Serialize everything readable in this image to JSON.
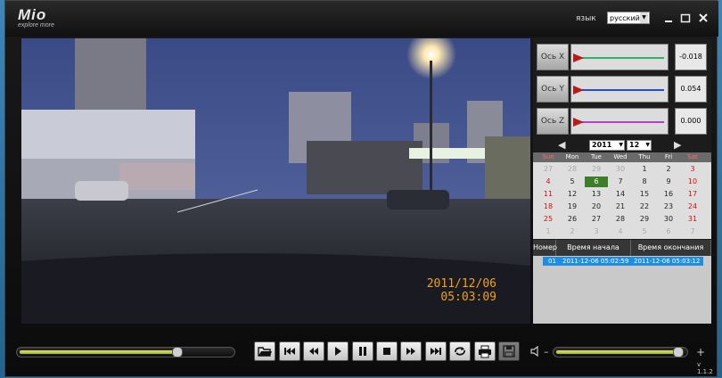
{
  "app": {
    "logo": "Mio",
    "logo_sub": "explore more",
    "version": "v 1.1.2"
  },
  "language": {
    "label": "язык",
    "selected": "русский"
  },
  "window_controls": [
    "minimize",
    "maximize",
    "close"
  ],
  "video": {
    "date": "2011/12/06",
    "time": "05:03:09"
  },
  "sensors": [
    {
      "label": "Ось X",
      "value": "-0.018",
      "color": "#2fb36a"
    },
    {
      "label": "Ось Y",
      "value": "0.054",
      "color": "#1f4fd6"
    },
    {
      "label": "Ось Z",
      "value": "0.000",
      "color": "#b03fd8"
    }
  ],
  "calendar": {
    "year": "2011",
    "month": "12",
    "days": [
      "Sun",
      "Mon",
      "Tue",
      "Wed",
      "Thu",
      "Fri",
      "Sat"
    ],
    "weeks": [
      [
        "27",
        "28",
        "29",
        "30",
        "1",
        "2",
        "3"
      ],
      [
        "4",
        "5",
        "6",
        "7",
        "8",
        "9",
        "10"
      ],
      [
        "11",
        "12",
        "13",
        "14",
        "15",
        "16",
        "17"
      ],
      [
        "18",
        "19",
        "20",
        "21",
        "22",
        "23",
        "24"
      ],
      [
        "25",
        "26",
        "27",
        "28",
        "29",
        "30",
        "31"
      ],
      [
        "1",
        "2",
        "3",
        "4",
        "5",
        "6",
        "7"
      ]
    ],
    "selected_day": "6"
  },
  "recordings": {
    "headers": [
      "Номер",
      "Время начала",
      "Время окончания"
    ],
    "rows": [
      {
        "num": "01",
        "start": "2011-12-06   05:02:59",
        "end": "2011-12-06   05:03:12"
      }
    ]
  },
  "playback": {
    "progress": 0.75,
    "volume": 0.97
  },
  "controls": [
    "open-folder",
    "skip-back",
    "rewind",
    "play",
    "pause",
    "stop",
    "fast-forward",
    "skip-forward",
    "loop",
    "print",
    "save"
  ]
}
